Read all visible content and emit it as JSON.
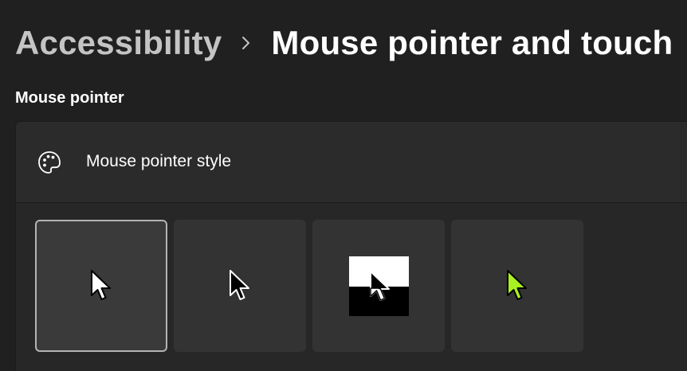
{
  "breadcrumb": {
    "parent": "Accessibility",
    "separator_icon": "chevron-right-icon",
    "current": "Mouse pointer and touch"
  },
  "section": {
    "label": "Mouse pointer"
  },
  "pointer_style_card": {
    "icon": "palette-icon",
    "title": "Mouse pointer style",
    "options": [
      {
        "name": "white",
        "icon": "white-pointer-icon",
        "selected": true
      },
      {
        "name": "black",
        "icon": "black-pointer-icon",
        "selected": false
      },
      {
        "name": "inverted",
        "icon": "inverted-pointer-icon",
        "selected": false
      },
      {
        "name": "custom",
        "icon": "custom-color-pointer-icon",
        "color": "#a8f021",
        "selected": false
      }
    ]
  },
  "colors": {
    "background": "#202020",
    "card": "#2b2b2b",
    "tile": "#333333",
    "selected_border": "#b4b4b4",
    "custom_pointer": "#a8f021"
  }
}
